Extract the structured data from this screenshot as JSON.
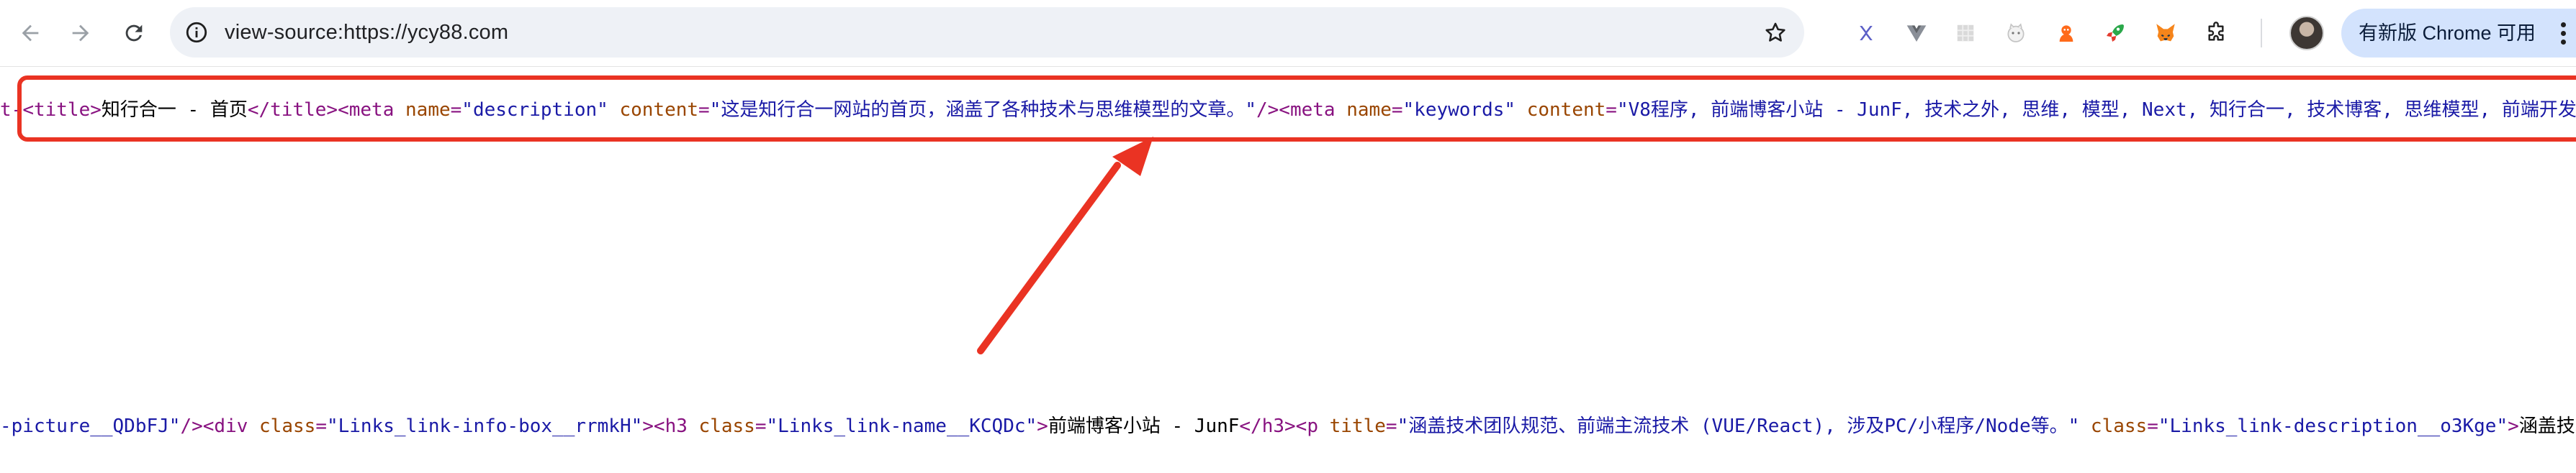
{
  "browser": {
    "url": "view-source:https://ycy88.com",
    "update_label": "有新版 Chrome 可用"
  },
  "extensions": [
    "x-extension-icon",
    "vue-devtools-icon",
    "grid-extension-icon",
    "cat-extension-icon",
    "fox-extension-icon",
    "rocket-extension-icon",
    "metamask-icon",
    "puzzle-icon"
  ],
  "source": {
    "line1": [
      {
        "t": "tag",
        "v": "t-"
      },
      {
        "t": "tag",
        "v": "<title>"
      },
      {
        "t": "txt",
        "v": "知行合一 - 首页"
      },
      {
        "t": "tag",
        "v": "</title><meta "
      },
      {
        "t": "attr",
        "v": "name"
      },
      {
        "t": "tag",
        "v": "="
      },
      {
        "t": "val",
        "v": "\"description\""
      },
      {
        "t": "tag",
        "v": " "
      },
      {
        "t": "attr",
        "v": "content"
      },
      {
        "t": "tag",
        "v": "="
      },
      {
        "t": "val",
        "v": "\"这是知行合一网站的首页，涵盖了各种技术与思维模型的文章。\""
      },
      {
        "t": "tag",
        "v": "/><meta "
      },
      {
        "t": "attr",
        "v": "name"
      },
      {
        "t": "tag",
        "v": "="
      },
      {
        "t": "val",
        "v": "\"keywords\""
      },
      {
        "t": "tag",
        "v": " "
      },
      {
        "t": "attr",
        "v": "content"
      },
      {
        "t": "tag",
        "v": "="
      },
      {
        "t": "val",
        "v": "\"V8程序, 前端博客小站 - JunF, 技术之外, 思维, 模型, Next, 知行合一, 技术博客, 思维模型, 前端开发"
      }
    ],
    "line2": [
      {
        "t": "val",
        "v": "-picture__QDbFJ\""
      },
      {
        "t": "tag",
        "v": "/><div "
      },
      {
        "t": "attr",
        "v": "class"
      },
      {
        "t": "tag",
        "v": "="
      },
      {
        "t": "val",
        "v": "\"Links_link-info-box__rrmkH\""
      },
      {
        "t": "tag",
        "v": "><h3 "
      },
      {
        "t": "attr",
        "v": "class"
      },
      {
        "t": "tag",
        "v": "="
      },
      {
        "t": "val",
        "v": "\"Links_link-name__KCQDc\""
      },
      {
        "t": "tag",
        "v": ">"
      },
      {
        "t": "txt",
        "v": "前端博客小站 - JunF"
      },
      {
        "t": "tag",
        "v": "</h3><p "
      },
      {
        "t": "attr",
        "v": "title"
      },
      {
        "t": "tag",
        "v": "="
      },
      {
        "t": "val",
        "v": "\"涵盖技术团队规范、前端主流技术 (VUE/React), 涉及PC/小程序/Node等。\""
      },
      {
        "t": "tag",
        "v": " "
      },
      {
        "t": "attr",
        "v": "class"
      },
      {
        "t": "tag",
        "v": "="
      },
      {
        "t": "val",
        "v": "\"Links_link-description__o3Kge\""
      },
      {
        "t": "tag",
        "v": ">"
      },
      {
        "t": "txt",
        "v": "涵盖技术"
      }
    ]
  },
  "colors": {
    "highlight": "#ea3323",
    "tag": "#881280",
    "attribute": "#994500",
    "value": "#1a1aa6"
  }
}
